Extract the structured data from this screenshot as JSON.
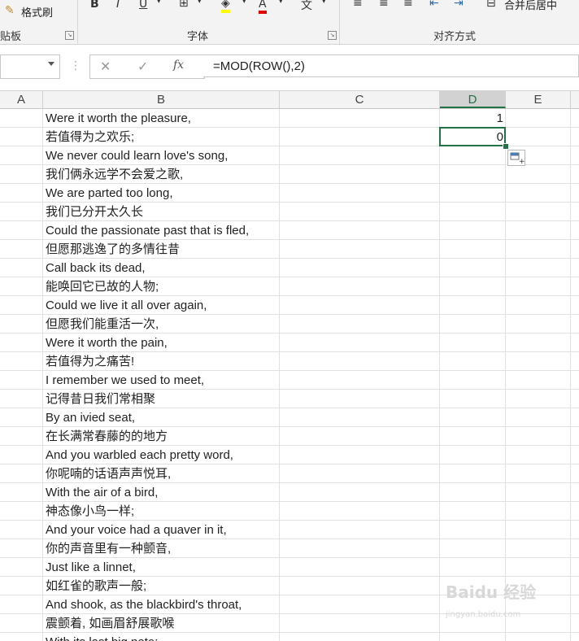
{
  "ribbon": {
    "format_painter": "格式刷",
    "clipboard_group": "贴板",
    "font_group": "字体",
    "alignment_group": "对齐方式",
    "merge_center": "合并后居中"
  },
  "formula_bar": {
    "formula": "=MOD(ROW(),2)",
    "fx": "fx"
  },
  "columns": [
    "A",
    "B",
    "C",
    "D",
    "E"
  ],
  "selected_column": "D",
  "cells_D": [
    "1",
    "0"
  ],
  "cells_B": [
    "Were it worth the pleasure,",
    "若值得为之欢乐;",
    "We never could learn love's song,",
    "我们俩永远学不会爱之歌,",
    "We are parted too long,",
    "我们已分开太久长",
    "Could the passionate past that is fled,",
    "但愿那逃逸了的多情往昔",
    "Call back its dead,",
    "能唤回它已故的人物;",
    "Could we live it all over again,",
    "但愿我们能重活一次,",
    "Were it worth the pain,",
    "若值得为之痛苦!",
    "I remember we used to meet,",
    "记得昔日我们常相聚",
    "By an ivied seat,",
    "在长满常春藤的的地方",
    "And you warbled each pretty word,",
    "你呢喃的话语声声悦耳,",
    "With the air of a bird,",
    "神态像小鸟一样;",
    "And your voice had a quaver in it,",
    "你的声音里有一种颤音,",
    "Just like a linnet,",
    "如红雀的歌声一般;",
    "And shook, as the blackbird's throat,",
    "震颤着, 如画眉舒展歌喉",
    "With its last big note;"
  ],
  "watermark": {
    "main": "Baidu 经验",
    "sub": "jingyan.baidu.com"
  }
}
